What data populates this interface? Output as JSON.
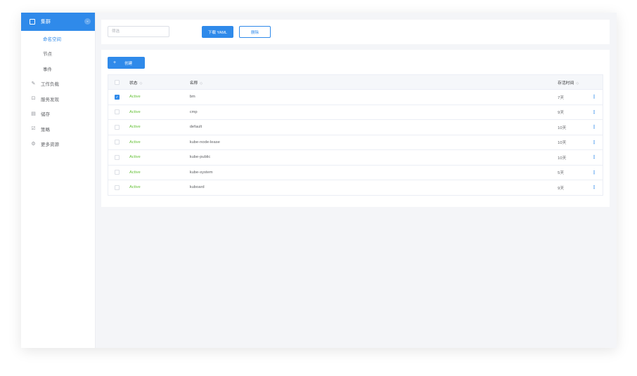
{
  "sidebar": {
    "group_label": "集群",
    "group_toggle": "⌄",
    "subitems": [
      {
        "label": "命名空间",
        "active": true
      },
      {
        "label": "节点",
        "active": false
      },
      {
        "label": "事件",
        "active": false
      }
    ],
    "items": [
      {
        "label": "工作负载",
        "icon": "wrench-icon",
        "glyph": "✎"
      },
      {
        "label": "服务发现",
        "icon": "service-discovery-icon",
        "glyph": "⊡"
      },
      {
        "label": "储存",
        "icon": "storage-icon",
        "glyph": "▤"
      },
      {
        "label": "策略",
        "icon": "policy-icon",
        "glyph": "☑"
      },
      {
        "label": "更多资源",
        "icon": "more-resources-icon",
        "glyph": "⚙"
      }
    ]
  },
  "toolbar": {
    "filter_placeholder": "筛选",
    "download_yaml_label": "下载 YAML",
    "delete_label": "删除"
  },
  "main": {
    "create_label": "创建",
    "create_icon": "+",
    "columns": {
      "status": "状态",
      "name": "名称",
      "age": "存活时间"
    },
    "sort_glyph": "◇",
    "action_glyph": "⋮",
    "rows": [
      {
        "checked": true,
        "status": "Active",
        "name": "bm",
        "age": "7天"
      },
      {
        "checked": false,
        "status": "Active",
        "name": "cmp",
        "age": "9天"
      },
      {
        "checked": false,
        "status": "Active",
        "name": "default",
        "age": "10天"
      },
      {
        "checked": false,
        "status": "Active",
        "name": "kube-node-lease",
        "age": "10天"
      },
      {
        "checked": false,
        "status": "Active",
        "name": "kube-public",
        "age": "10天"
      },
      {
        "checked": false,
        "status": "Active",
        "name": "kube-system",
        "age": "5天"
      },
      {
        "checked": false,
        "status": "Active",
        "name": "kuboard",
        "age": "9天"
      }
    ]
  },
  "colors": {
    "accent": "#2f8aea",
    "status_active": "#67c23a"
  }
}
